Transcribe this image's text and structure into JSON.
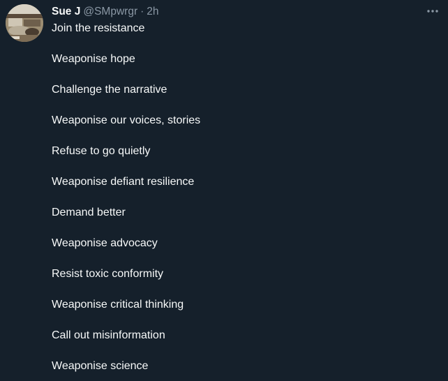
{
  "author": {
    "name": "Sue J",
    "handle": "@SMpwrgr",
    "separator": "·",
    "time": "2h"
  },
  "icons": {
    "more": "more-horizontal-icon",
    "avatar": "profile-photo"
  },
  "colors": {
    "background": "#15202b",
    "text_primary": "#f7f9f9",
    "text_secondary": "#8b98a5"
  },
  "tweet": {
    "lines": [
      "Join the resistance",
      "Weaponise hope",
      "Challenge the narrative",
      "Weaponise our voices, stories",
      "Refuse to go quietly",
      "Weaponise defiant resilience",
      "Demand better",
      "Weaponise advocacy",
      "Resist toxic conformity",
      "Weaponise critical thinking",
      "Call out misinformation",
      "Weaponise science"
    ]
  }
}
